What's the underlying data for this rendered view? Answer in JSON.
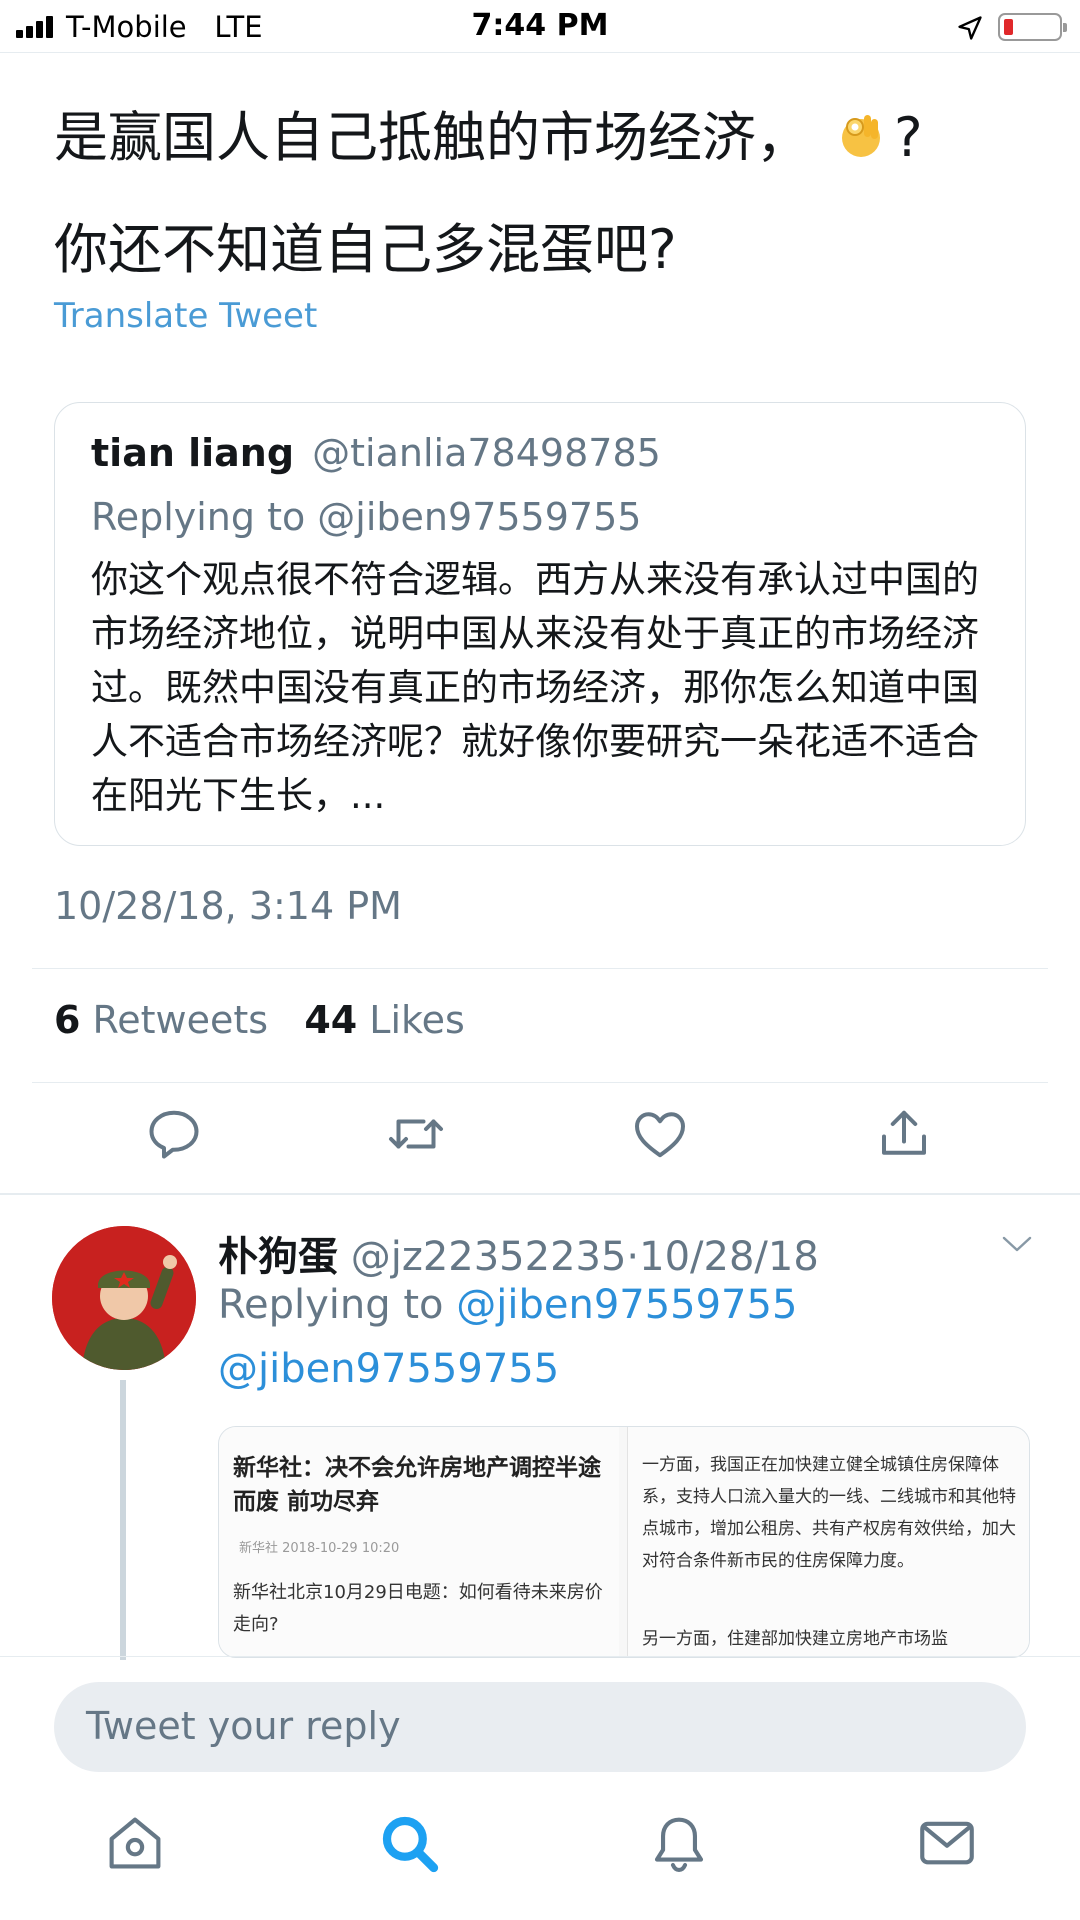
{
  "status_bar": {
    "carrier": "T-Mobile",
    "network": "LTE",
    "time": "7:44 PM",
    "battery_color": "#e0282a"
  },
  "tweet": {
    "line1": "是赢国人自己抵触的市场经济，",
    "line1_suffix": "?",
    "line2": "你还不知道自己多混蛋吧?",
    "emoji": "ok-hand",
    "translate": "Translate Tweet",
    "timestamp": "10/28/18, 3:14 PM",
    "retweets_count": "6",
    "retweets_label": "Retweets",
    "likes_count": "44",
    "likes_label": "Likes"
  },
  "quote": {
    "name": "tian liang",
    "handle": "@tianlia78498785",
    "replying_to": "Replying to @jiben97559755",
    "body": "你这个观点很不符合逻辑。西方从来没有承认过中国的市场经济地位，说明中国从来没有处于真正的市场经济过。既然中国没有真正的市场经济，那你怎么知道中国人不适合市场经济呢？就好像你要研究一朵花适不适合在阳光下生长，..."
  },
  "actions": [
    "reply-icon",
    "retweet-icon",
    "like-icon",
    "share-icon"
  ],
  "reply": {
    "name": "朴狗蛋",
    "handle": "@jz22352235",
    "date": "10/28/18",
    "replying_prefix": "Replying to ",
    "replying_handle": "@jiben97559755",
    "mention": "@jiben97559755",
    "media_left": {
      "title": "新华社：决不会允许房地产调控半途而废 前功尽弃",
      "date": "新华社 2018-10-29 10:20",
      "text": "新华社北京10月29日电题：如何看待未来房价走向?"
    },
    "media_right": {
      "para1": "一方面，我国正在加快建立健全城镇住房保障体系，支持人口流入量大的一线、二线城市和其他特点城市，增加公租房、共有产权房有效供给，加大对符合条件新市民的住房保障力度。",
      "para2": "另一方面，住建部加快建立房地产市场监"
    }
  },
  "reply_box": {
    "placeholder": "Tweet your reply"
  },
  "tab_bar": [
    "home-icon",
    "search-icon",
    "notifications-icon",
    "messages-icon"
  ],
  "colors": {
    "link": "#2c8fd9",
    "muted": "#657786",
    "accent": "#1da1f2"
  }
}
